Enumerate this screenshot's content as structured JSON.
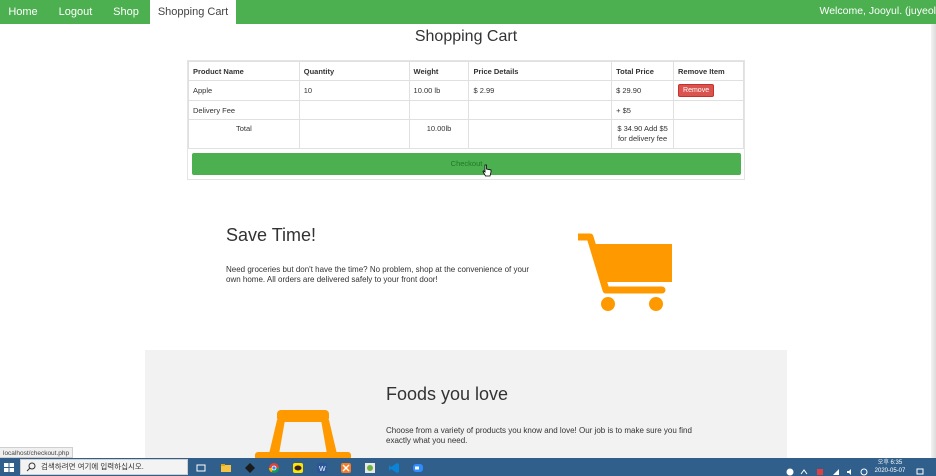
{
  "nav": {
    "items": [
      "Home",
      "Logout",
      "Shop",
      "Shopping Cart"
    ],
    "welcome": "Welcome, Jooyul. (juyeol"
  },
  "page": {
    "title": "Shopping Cart"
  },
  "cart": {
    "headers": [
      "Product Name",
      "Quantity",
      "Weight",
      "Price Details",
      "Total Price",
      "Remove Item"
    ],
    "item": {
      "name": "Apple",
      "quantity": "10",
      "weight": "10.00 lb",
      "price": "$ 2.99",
      "total": "$ 29.90",
      "remove_label": "Remove"
    },
    "delivery": {
      "label": "Delivery Fee",
      "fee": "+ $5"
    },
    "total": {
      "label": "Total",
      "weight": "10.00lb",
      "price_line1": "$ 34.90 Add $5",
      "price_line2": "for delivery fee"
    },
    "checkout_label": "Checkout"
  },
  "save": {
    "title": "Save Time!",
    "text": "Need groceries but don't have the time? No problem, shop at the convenience of your own home. All orders are delivered safely to your front door!"
  },
  "foods": {
    "title": "Foods you love",
    "text": "Choose from a variety of products you know and love! Our job is to make sure you find exactly what you need."
  },
  "status_bar": {
    "url": "localhost/checkout.php"
  },
  "taskbar": {
    "search_placeholder": "검색하려면 여기에 입력하십시오.",
    "time": "오후 6:35",
    "date": "2020-05-07"
  },
  "colors": {
    "accent": "#4CAF50",
    "danger": "#d9534f",
    "icon_orange": "#FF9900"
  }
}
